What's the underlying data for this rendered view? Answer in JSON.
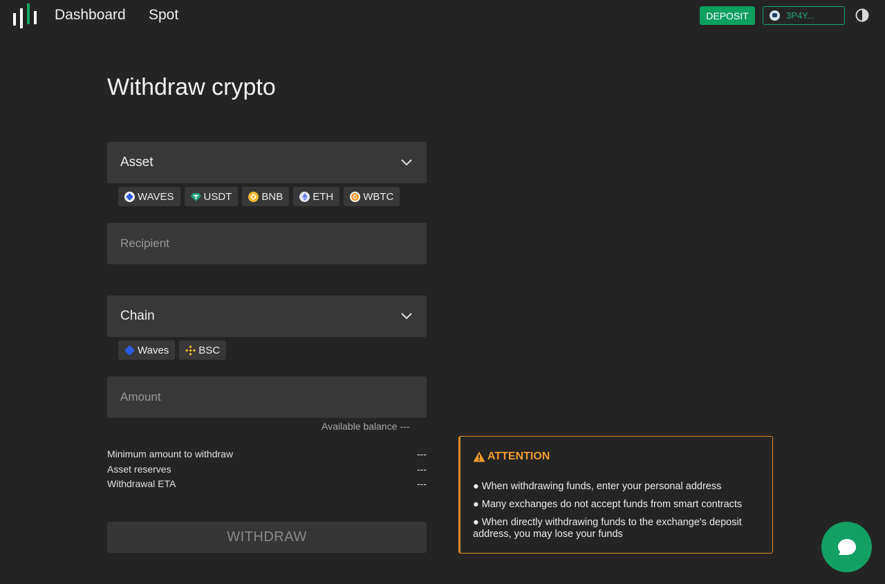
{
  "header": {
    "nav": [
      "Dashboard",
      "Spot"
    ],
    "deposit_label": "DEPOSIT",
    "wallet_label": "3P4Y..."
  },
  "page": {
    "title": "Withdraw crypto"
  },
  "form": {
    "asset_label": "Asset",
    "assets": [
      "WAVES",
      "USDT",
      "BNB",
      "ETH",
      "WBTC"
    ],
    "recipient_placeholder": "Recipient",
    "chain_label": "Chain",
    "chains": [
      "Waves",
      "BSC"
    ],
    "amount_placeholder": "Amount",
    "available_balance": "Available balance ---"
  },
  "info": [
    {
      "label": "Minimum amount to withdraw",
      "value": "---"
    },
    {
      "label": "Asset reserves",
      "value": "---"
    },
    {
      "label": "Withdrawal ETA",
      "value": "---"
    }
  ],
  "withdraw_label": "WITHDRAW",
  "attention": {
    "title": "ATTENTION",
    "items": [
      "● When withdrawing funds, enter your personal address",
      "● Many exchanges do not accept funds from smart contracts",
      "● When directly withdrawing funds to the exchange's deposit address, you may lose your funds"
    ]
  },
  "colors": {
    "accent": "#0fa060",
    "warning": "#f29a2e",
    "background": "#242424",
    "field": "#383838"
  },
  "icons": [
    "logo-icon",
    "theme-toggle-icon",
    "chevron-down-icon",
    "waves-icon",
    "usdt-icon",
    "bnb-icon",
    "eth-icon",
    "wbtc-icon",
    "bsc-icon",
    "warning-icon",
    "chat-icon"
  ]
}
